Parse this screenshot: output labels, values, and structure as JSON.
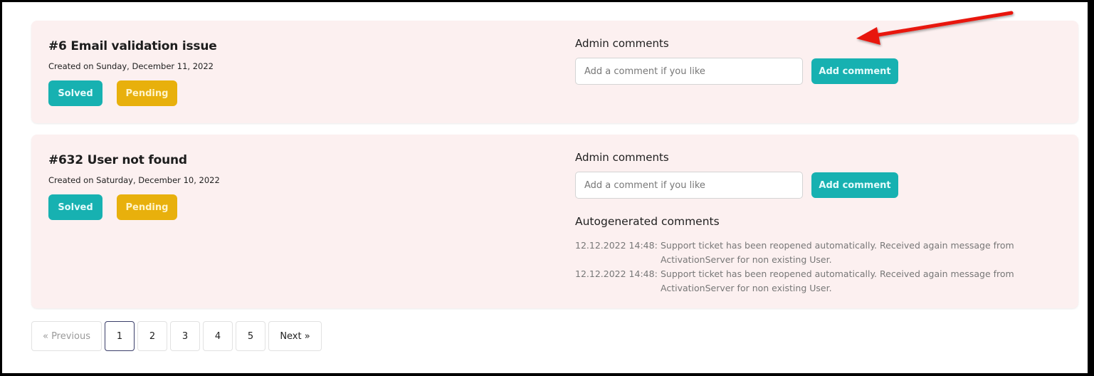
{
  "tickets": [
    {
      "title": "#6 Email validation issue",
      "created": "Created on Sunday, December 11, 2022",
      "solved_label": "Solved",
      "pending_label": "Pending",
      "admin_comments_label": "Admin comments",
      "comment_placeholder": "Add a comment if you like",
      "add_comment_label": "Add comment"
    },
    {
      "title": "#632 User not found",
      "created": "Created on Saturday, December 10, 2022",
      "solved_label": "Solved",
      "pending_label": "Pending",
      "admin_comments_label": "Admin comments",
      "comment_placeholder": "Add a comment if you like",
      "add_comment_label": "Add comment",
      "autogenerated_label": "Autogenerated comments",
      "autogenerated": [
        {
          "time": "12.12.2022 14:48:",
          "message": "Support ticket has been reopened automatically. Received again message from ActivationServer for non existing User."
        },
        {
          "time": "12.12.2022 14:48:",
          "message": "Support ticket has been reopened automatically. Received again message from ActivationServer for non existing User."
        }
      ]
    }
  ],
  "pagination": {
    "previous": "« Previous",
    "pages": [
      "1",
      "2",
      "3",
      "4",
      "5"
    ],
    "current": "1",
    "next": "Next »"
  },
  "annotation": {
    "icon": "red-arrow-icon",
    "color": "#e8140e"
  },
  "colors": {
    "solved": "#17b1b1",
    "pending": "#e8b00c",
    "card_bg": "#fcf0f0"
  }
}
